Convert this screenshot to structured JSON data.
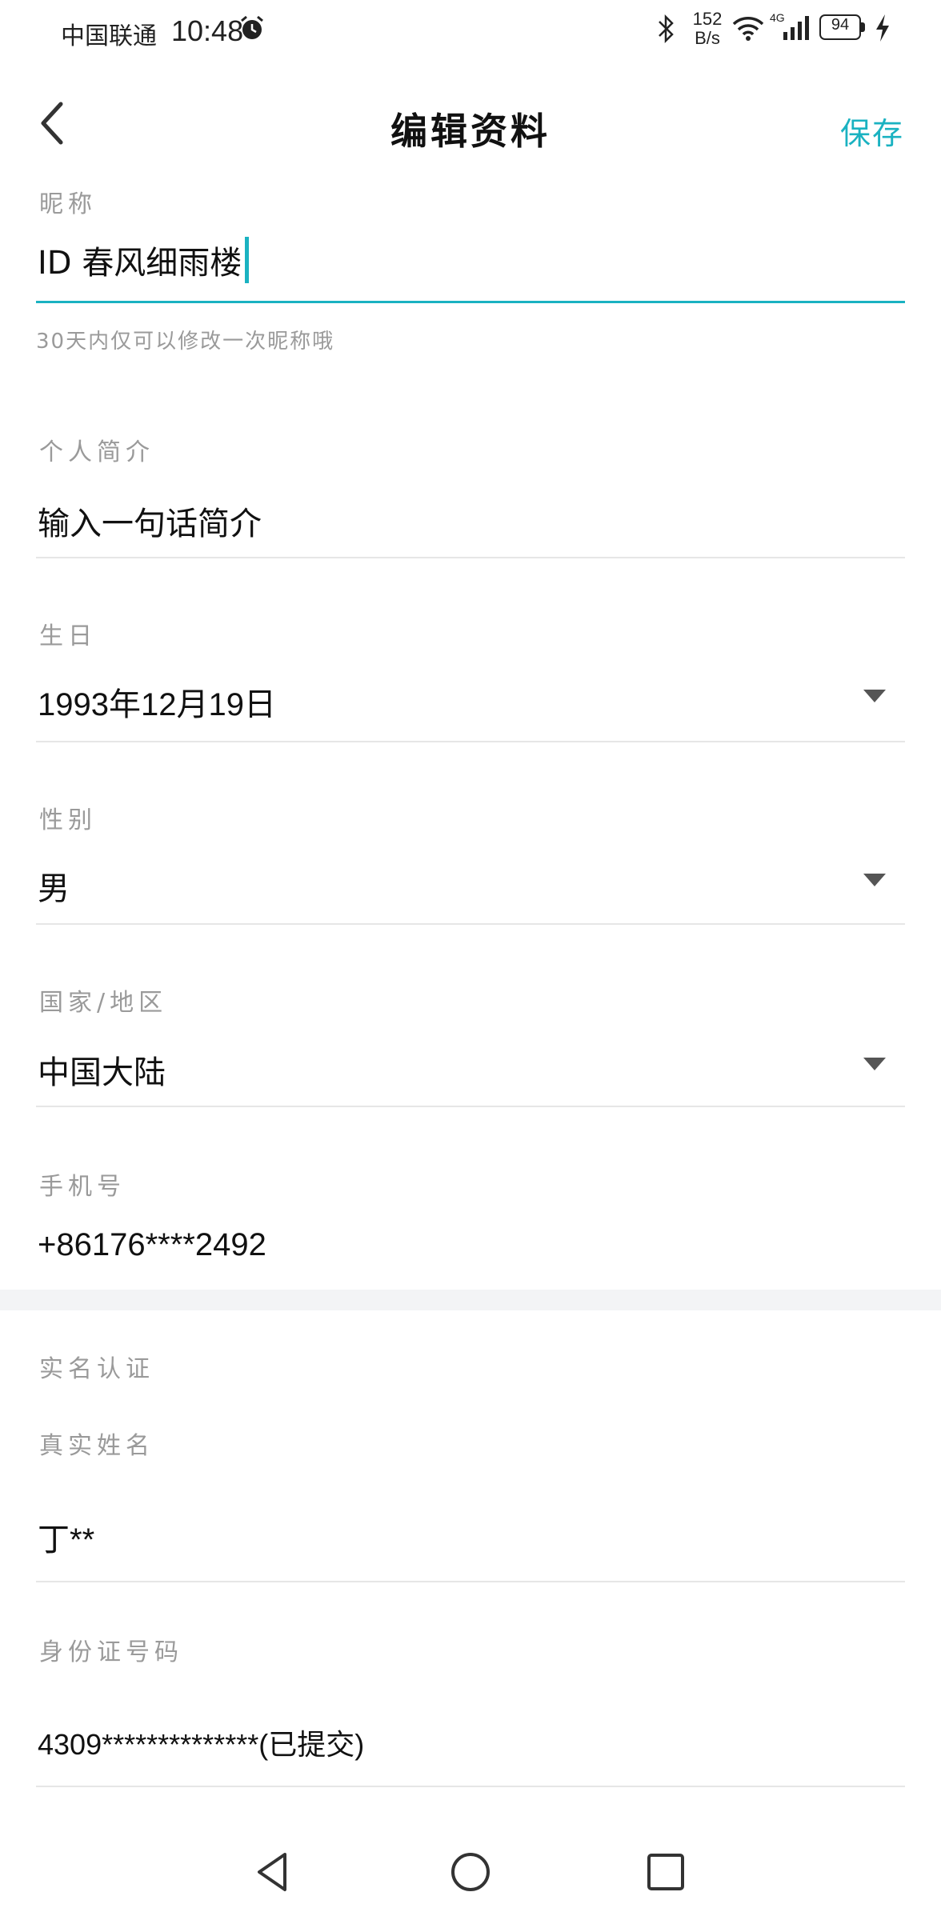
{
  "status_bar": {
    "carrier": "中国联通",
    "time": "10:48",
    "speed_value": "152",
    "speed_unit": "B/s",
    "network_type": "4G",
    "battery": "94"
  },
  "header": {
    "title": "编辑资料",
    "save_label": "保存"
  },
  "nickname": {
    "label": "昵称",
    "value": "ID 春风细雨楼",
    "hint": "30天内仅可以修改一次昵称哦"
  },
  "bio": {
    "label": "个人简介",
    "placeholder": "输入一句话简介"
  },
  "birthday": {
    "label": "生日",
    "value": "1993年12月19日"
  },
  "gender": {
    "label": "性别",
    "value": "男"
  },
  "region": {
    "label": "国家/地区",
    "value": "中国大陆"
  },
  "phone": {
    "label": "手机号",
    "value": "+86176****2492"
  },
  "verification": {
    "section_title": "实名认证",
    "name_label": "真实姓名",
    "name_value": "丁**",
    "id_label": "身份证号码",
    "id_value": "4309**************(已提交)"
  },
  "colors": {
    "accent": "#1ab2c1",
    "label_gray": "#9a9a9a",
    "divider": "#e6e6e6"
  },
  "icons": {
    "back": "chevron-left-icon",
    "dropdown": "triangle-down-icon",
    "nav_back": "triangle-back-icon",
    "nav_home": "circle-home-icon",
    "nav_recent": "square-recent-icon"
  }
}
